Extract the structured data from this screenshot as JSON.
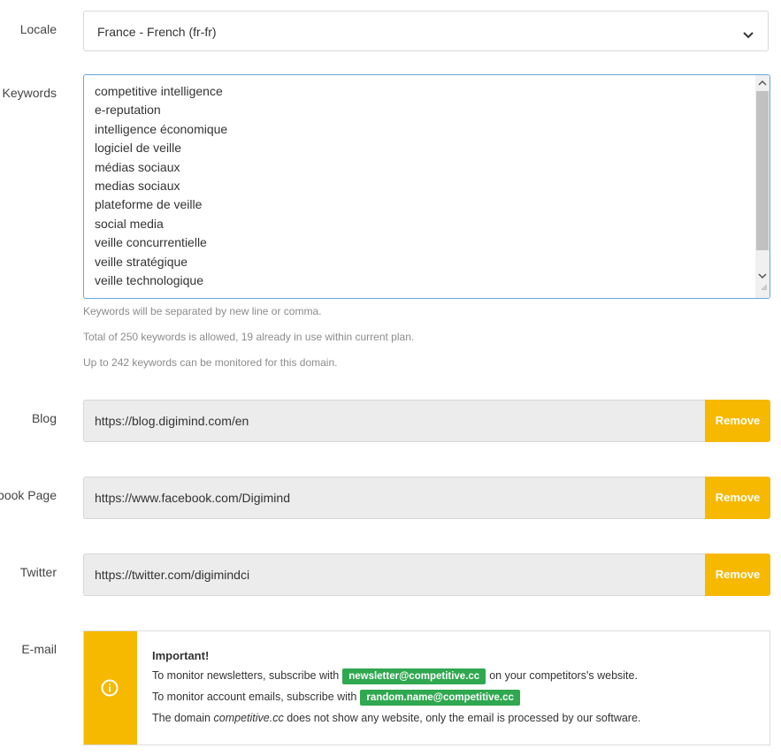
{
  "locale": {
    "label": "Locale",
    "value": "France - French (fr-fr)"
  },
  "keywords": {
    "label": "Keywords",
    "items": [
      "competitive intelligence",
      "e-reputation",
      "intelligence économique",
      "logiciel de veille",
      "médias sociaux",
      "medias sociaux",
      "plateforme de veille",
      "social media",
      "veille concurrentielle",
      "veille stratégique",
      "veille technologique"
    ],
    "help": [
      "Keywords will be separated by new line or comma.",
      "Total of 250 keywords is allowed, 19 already in use within current plan.",
      "Up to 242 keywords can be monitored for this domain."
    ]
  },
  "blog": {
    "label": "Blog",
    "value": "https://blog.digimind.com/en",
    "button": "Remove"
  },
  "facebook": {
    "label": "Facebook Page",
    "value": "https://www.facebook.com/Digimind",
    "button": "Remove"
  },
  "twitter": {
    "label": "Twitter",
    "value": "https://twitter.com/digimindci",
    "button": "Remove"
  },
  "email": {
    "label": "E-mail",
    "title": "Important!",
    "line1_before": "To monitor newsletters, subscribe with",
    "line1_badge": "newsletter@competitive.cc",
    "line1_after": "on your competitors's website.",
    "line2_before": "To monitor account emails, subscribe with",
    "line2_badge": "random.name@competitive.cc",
    "line3_before": "The domain",
    "line3_domain": "competitive.cc",
    "line3_after": "does not show any website, only the email is processed by our software."
  },
  "colors": {
    "accent": "#f7b800",
    "badge": "#2fa84f",
    "focus_border": "#6aa6d8"
  },
  "icons": [
    "chevron-down-icon",
    "info-icon",
    "scroll-up-icon",
    "scroll-down-icon",
    "resize-grip-icon"
  ]
}
